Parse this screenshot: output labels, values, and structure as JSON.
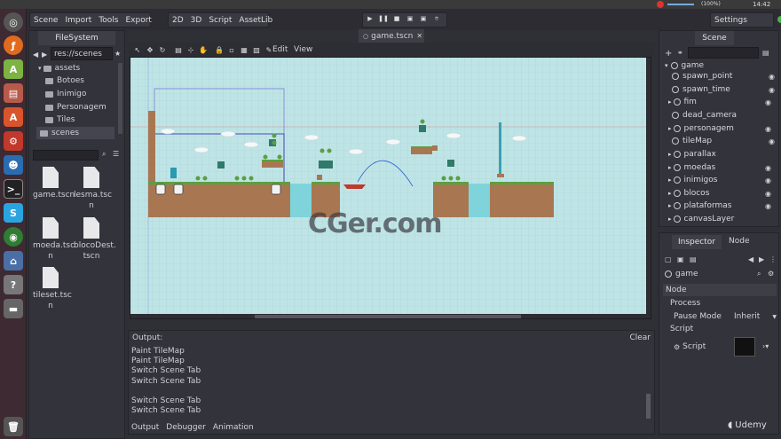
{
  "system": {
    "battery": "(100%)",
    "time": "14:42"
  },
  "menu": {
    "left": [
      "Scene",
      "Import",
      "Tools",
      "Export"
    ],
    "modes": [
      "2D",
      "3D",
      "Script",
      "AssetLib"
    ],
    "settings": "Settings"
  },
  "filesystem": {
    "tab": "FileSystem",
    "path": "res://scenes",
    "tree": [
      "assets",
      "Botoes",
      "Inimigo",
      "Personagem",
      "Tiles",
      "scenes"
    ],
    "files": [
      [
        "game.tscn"
      ],
      [
        "lesma.tsc",
        "n"
      ],
      [
        "moeda.tsc",
        "n"
      ],
      [
        "blocoDest.",
        "tscn"
      ],
      [
        "tileset.tsc",
        "n"
      ]
    ]
  },
  "editor": {
    "tab": "game.tscn",
    "edit": "Edit",
    "view": "View"
  },
  "watermark": "CGer.com",
  "scene": {
    "tab": "Scene",
    "root": "game",
    "nodes": [
      "spawn_point",
      "spawn_time",
      "fim",
      "dead_camera",
      "personagem",
      "tileMap",
      "parallax",
      "moedas",
      "inimigos",
      "blocos",
      "plataformas",
      "canvasLayer"
    ]
  },
  "inspector": {
    "tabs": [
      "Inspector",
      "Node"
    ],
    "object": "game",
    "section": "Node",
    "process": "Process",
    "pause_mode": "Pause Mode",
    "pause_value": "Inherit",
    "script_section": "Script",
    "script": "Script"
  },
  "output": {
    "title": "Output:",
    "clear": "Clear",
    "lines": [
      "Paint TileMap",
      "Paint TileMap",
      "Switch Scene Tab",
      "Switch Scene Tab",
      "",
      "Switch Scene Tab",
      "Switch Scene Tab"
    ],
    "tabs": [
      "Output",
      "Debugger",
      "Animation"
    ]
  },
  "brand": "Udemy"
}
